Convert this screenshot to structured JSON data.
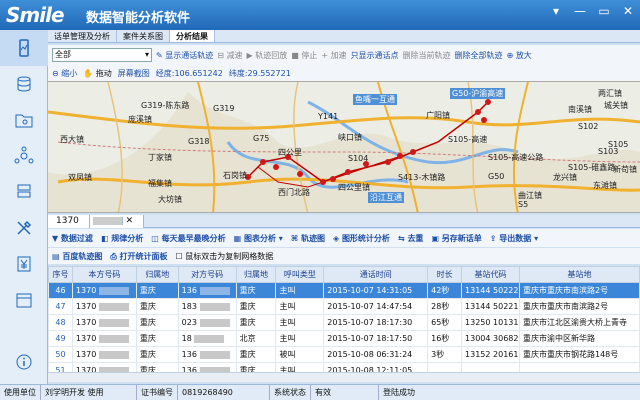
{
  "app": {
    "logo": "Smile",
    "title": "数据智能分析软件",
    "win_buttons": [
      "▾",
      "—",
      "▭",
      "✕"
    ]
  },
  "tabs": [
    "话单管理及分析",
    "案件关系图",
    "分析结果"
  ],
  "toolbar1": {
    "dropdown_value": "全部",
    "show_track": "显示通话轨迹",
    "reduce": "减速",
    "replay": "轨迹回放",
    "stop": "停止",
    "speed_up": "加速",
    "only_points": "只显示通话点",
    "delete_current": "删除当前轨迹",
    "delete_all": "删除全部轨迹",
    "zoom_in": "放大"
  },
  "toolbar2": {
    "zoom_out": "缩小",
    "pan": "拖动",
    "screenshot": "屏幕截图",
    "lon_label": "经度:",
    "lon_value": "106.651242",
    "lat_label": "纬度:",
    "lat_value": "29.552721"
  },
  "map_labels": [
    "G319-陈东路",
    "庞溪镇",
    "西大镇",
    "双凤镇",
    "丁家镇",
    "福集镇",
    "大坊镇",
    "石岗镇",
    "峡口镇",
    "广阳镇",
    "四公里",
    "四公里镇",
    "西门北路",
    "龙兴镇",
    "S105-高速",
    "S102",
    "S103",
    "S413-木镇路",
    "东滩镇",
    "南溪镇",
    "新苟镇",
    "S105-碓鑫路",
    "S105",
    "S5",
    "G50-沪渝高速",
    "曲江镇",
    "鱼嘴一互通",
    "G318",
    "S104",
    "G75",
    "G319",
    "沿江互通",
    "G50",
    "城关镇",
    "两汇镇",
    "Y141",
    "S105-高速公路"
  ],
  "subtab": "1370",
  "toolbar3": [
    "数据过滤",
    "规律分析",
    "每天最早最晚分析",
    "图表分析",
    "轨迹图",
    "图形统计分析",
    "去重",
    "另存新话单",
    "导出数据"
  ],
  "toolbar4": {
    "baidu": "百度轨迹图",
    "print": "打开统计面板",
    "checkbox": "鼠标双击为复制网格数据"
  },
  "table": {
    "headers": [
      "序号",
      "本方号码",
      "归属地",
      "对方号码",
      "归属地",
      "呼叫类型",
      "通话时间",
      "时长",
      "基站代码",
      "基站地"
    ],
    "rows": [
      {
        "idx": "46",
        "own": "1370",
        "own_loc": "重庆",
        "other": "136",
        "other_loc": "重庆",
        "type": "主叫",
        "time": "2015-10-07 14:31:05",
        "dur": "42秒",
        "code": "13144 50222",
        "addr": "重庆市重庆市南滨路2号"
      },
      {
        "idx": "47",
        "own": "1370",
        "own_loc": "重庆",
        "other": "183",
        "other_loc": "重庆",
        "type": "主叫",
        "time": "2015-10-07 14:47:54",
        "dur": "28秒",
        "code": "13144 50221",
        "addr": "重庆市重庆市南滨路2号"
      },
      {
        "idx": "48",
        "own": "1370",
        "own_loc": "重庆",
        "other": "023",
        "other_loc": "重庆",
        "type": "主叫",
        "time": "2015-10-07 18:17:30",
        "dur": "65秒",
        "code": "13250 10131",
        "addr": "重庆市江北区渝贵大桥上青寺"
      },
      {
        "idx": "49",
        "own": "1370",
        "own_loc": "重庆",
        "other": "18",
        "other_loc": "北京",
        "type": "主叫",
        "time": "2015-10-07 18:17:50",
        "dur": "16秒",
        "code": "13004 30682",
        "addr": "重庆市渝中区新华路"
      },
      {
        "idx": "50",
        "own": "1370",
        "own_loc": "重庆",
        "other": "136",
        "other_loc": "重庆",
        "type": "被叫",
        "time": "2015-10-08 06:31:24",
        "dur": "3秒",
        "code": "13152 20161",
        "addr": "重庆市重庆市钢花路148号"
      },
      {
        "idx": "51",
        "own": "1370",
        "own_loc": "重庆",
        "other": "136",
        "other_loc": "重庆",
        "type": "主叫",
        "time": "2015-10-08 12:11:05",
        "dur": "",
        "code": "",
        "addr": ""
      }
    ]
  },
  "status": {
    "unit_label": "使用单位",
    "unit": "刘学明开发 使用",
    "cert_label": "证书编号",
    "cert": "0819268490",
    "sys_label": "系统状态",
    "sys": "有效",
    "login": "登陆成功"
  }
}
